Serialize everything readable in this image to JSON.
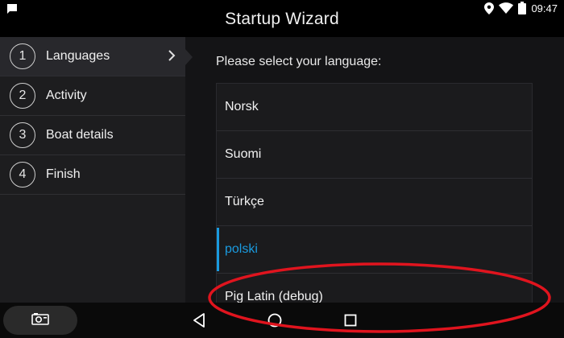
{
  "window": {
    "title": "Startup Wizard"
  },
  "status": {
    "time": "09:47"
  },
  "steps": [
    {
      "num": "1",
      "label": "Languages"
    },
    {
      "num": "2",
      "label": "Activity"
    },
    {
      "num": "3",
      "label": "Boat details"
    },
    {
      "num": "4",
      "label": "Finish"
    }
  ],
  "main": {
    "prompt": "Please select your language:",
    "languages": [
      {
        "label": "Norsk"
      },
      {
        "label": "Suomi"
      },
      {
        "label": "Türkçe"
      },
      {
        "label": "polski",
        "selected": true
      },
      {
        "label": "Pig Latin (debug)"
      }
    ]
  },
  "colors": {
    "accent": "#1a9be0",
    "annotation": "#e0141e"
  },
  "icons": {
    "status_left": "message-icon",
    "status_right": [
      "location-icon",
      "wifi-icon",
      "battery-icon"
    ],
    "nav": [
      "back-icon",
      "home-icon",
      "recents-icon"
    ],
    "camera": "camera-icon"
  }
}
